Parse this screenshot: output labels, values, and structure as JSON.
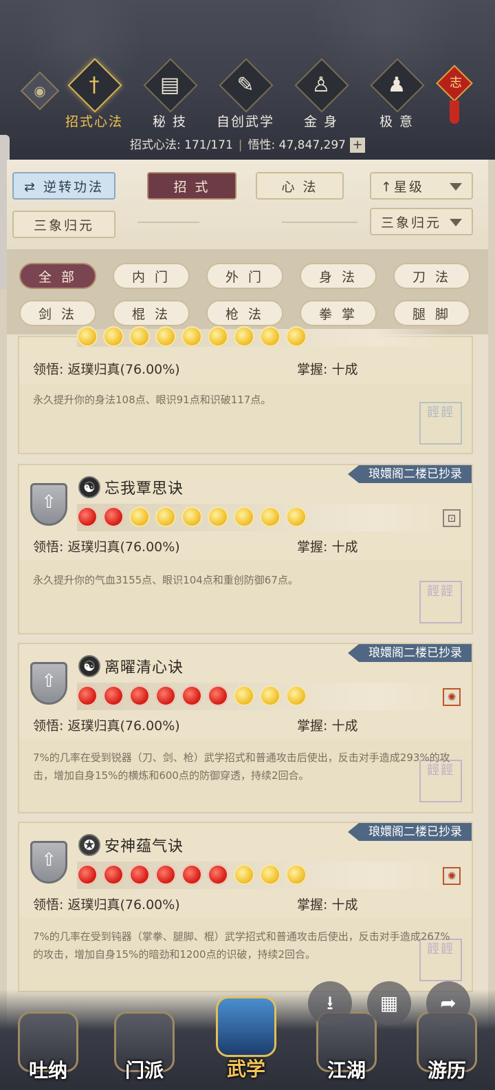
{
  "header": {
    "eye_icon": "eye-icon",
    "tabs": [
      {
        "label": "招式心法",
        "icon": "sword-icon",
        "active": true
      },
      {
        "label": "秘 技",
        "icon": "book-icon",
        "active": false
      },
      {
        "label": "自创武学",
        "icon": "scroll-icon",
        "active": false
      },
      {
        "label": "金 身",
        "icon": "meditate-icon",
        "active": false
      },
      {
        "label": "极 意",
        "icon": "stance-icon",
        "active": false
      }
    ],
    "knot_char": "志",
    "stats": {
      "moves_label": "招式心法: 171/171",
      "insight_label": "悟性: 47,847,297",
      "plus": "+"
    }
  },
  "controls": {
    "reverse_button": "逆转功法",
    "reverse_icon": "⇄",
    "tab_moves": "招 式",
    "tab_mind": "心 法",
    "sort_label": "星级",
    "sort_arrow": "↑",
    "left_filter": "三象归元",
    "right_select": "三象归元"
  },
  "filters": [
    "全 部",
    "内 门",
    "外 门",
    "身 法",
    "刀 法",
    "剑 法",
    "棍 法",
    "枪 法",
    "拳 掌",
    "腿 脚"
  ],
  "cards": [
    {
      "partial": true,
      "stars": [
        "gold",
        "gold",
        "gold",
        "gold",
        "gold",
        "gold",
        "gold",
        "gold",
        "gold"
      ],
      "comprehension": "领悟:  返璞归真(76.00%)",
      "mastery": "掌握:  十成",
      "description": "永久提升你的身法108点、眼识91点和识破117点。"
    },
    {
      "title": "忘我覃思诀",
      "badge": "琅嬛阁二楼已抄录",
      "emblem": "☯",
      "stars": [
        "red",
        "red",
        "gold",
        "gold",
        "gold",
        "gold",
        "gold",
        "gold",
        "gold"
      ],
      "comprehension": "领悟:  返璞归真(76.00%)",
      "mastery": "掌握:  十成",
      "description": "永久提升你的气血3155点、眼识104点和重创防御67点。"
    },
    {
      "title": "离曜清心诀",
      "badge": "琅嬛阁二楼已抄录",
      "emblem": "☯",
      "stars": [
        "red",
        "red",
        "red",
        "red",
        "red",
        "red",
        "gold",
        "gold",
        "gold"
      ],
      "comprehension": "领悟:  返璞归真(76.00%)",
      "mastery": "掌握:  十成",
      "description": "7%的几率在受到锐器（刀、剑、枪）武学招式和普通攻击后使出，反击对手造成293%的攻击，增加自身15%的横炼和600点的防御穿透，持续2回合。"
    },
    {
      "title": "安神蕴气诀",
      "badge": "琅嬛阁二楼已抄录",
      "emblem": "✪",
      "stars": [
        "red",
        "red",
        "red",
        "red",
        "red",
        "red",
        "gold",
        "gold",
        "gold"
      ],
      "comprehension": "领悟:  返璞归真(76.00%)",
      "mastery": "掌握:  十成",
      "description": "7%的几率在受到钝器（掌拳、腿脚、棍）武学招式和普通攻击后使出，反击对手造成267%的攻击，增加自身15%的暗劲和1200点的识破，持续2回合。"
    }
  ],
  "bottom_nav": [
    {
      "label": "吐纳",
      "active": false
    },
    {
      "label": "门派",
      "active": false
    },
    {
      "label": "武学",
      "active": true
    },
    {
      "label": "江湖",
      "active": false
    },
    {
      "label": "游历",
      "active": false
    }
  ],
  "floating": {
    "download": "⭳",
    "grid": "▦",
    "share": "➦"
  }
}
